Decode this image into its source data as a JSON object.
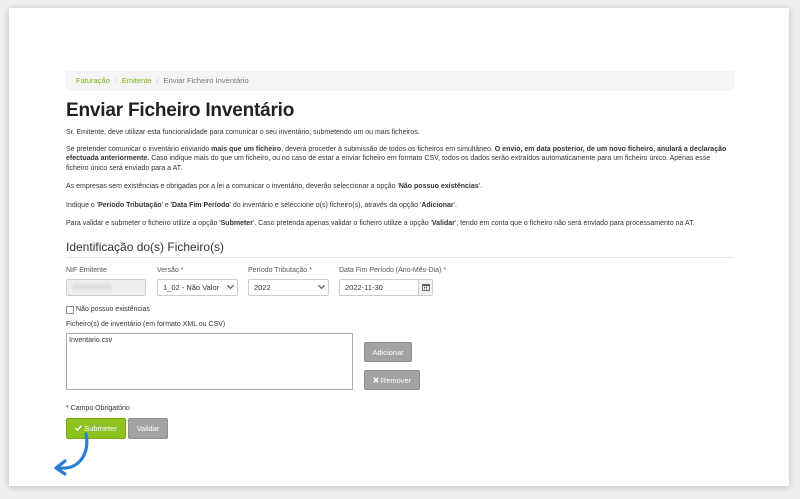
{
  "breadcrumb": {
    "items": [
      "Faturação",
      "Emitente",
      "Enviar Ficheiro Inventário"
    ]
  },
  "page": {
    "title": "Enviar Ficheiro Inventário"
  },
  "intro": {
    "p1": "Sr. Emitente, deve utilizar esta funcionalidade para comunicar o seu inventário, submetendo um ou mais ficheiros.",
    "p2_a": "Se pretender comunicar o inventário enviando ",
    "p2_b": "mais que um ficheiro",
    "p2_c": ", deverá proceder à submissão de todos os ficheiros em simultâneo. ",
    "p2_d": "O envio, em data posterior, de um novo ficheiro, anulará a declaração efectuada anteriormente.",
    "p2_e": " Caso indique mais do que um ficheiro, ou no caso de estar a enviar ficheiro em formato CSV, todos os dados serão extraídos automaticamente para um ficheiro único. Apenas esse ficheiro único será enviado para a AT.",
    "p3_a": "As empresas sem existências e obrigadas por a lei a comunicar o inventário, deverão seleccionar a opção '",
    "p3_b": "Não possuo existências",
    "p3_c": "'.",
    "p4_a": "Indique o '",
    "p4_b": "Período Tributação",
    "p4_c": "' e '",
    "p4_d": "Data Fim Período",
    "p4_e": "' do inventário e seleccione o(s) ficheiro(s), através da opção '",
    "p4_f": "Adicionar",
    "p4_g": "'.",
    "p5_a": "Para validar e submeter o ficheiro utilize a opção '",
    "p5_b": "Submeter",
    "p5_c": "'. Caso pretenda apenas validar o ficheiro utilize a opção '",
    "p5_d": "Validar",
    "p5_e": "', tendo em conta que o ficheiro não será enviado para processamento na AT."
  },
  "section": {
    "title": "Identificação do(s) Ficheiro(s)"
  },
  "form": {
    "nif_label": "NIF Emitente",
    "versao_label": "Versão *",
    "versao_value": "1_02 - Não Valor",
    "periodo_label": "Período Tributação *",
    "periodo_value": "2022",
    "data_label": "Data Fim Período (Ano-Mês-Dia) *",
    "data_value": "2022-11-30",
    "no_stock_label": "Não possuo existências",
    "files_label": "Ficheiro(s) de inventário (em formato XML ou CSV)",
    "files": [
      "Inventario.csv"
    ],
    "add_button": "Adicionar",
    "remove_button": "Remover",
    "required_note": "* Campo Obrigatório",
    "submit_button": "Submeter",
    "validate_button": "Validar"
  },
  "colors": {
    "accent_green": "#8dc21f",
    "link_green": "#7ab317",
    "button_grey": "#a3a3a3",
    "arrow_blue": "#2a7fd4"
  }
}
